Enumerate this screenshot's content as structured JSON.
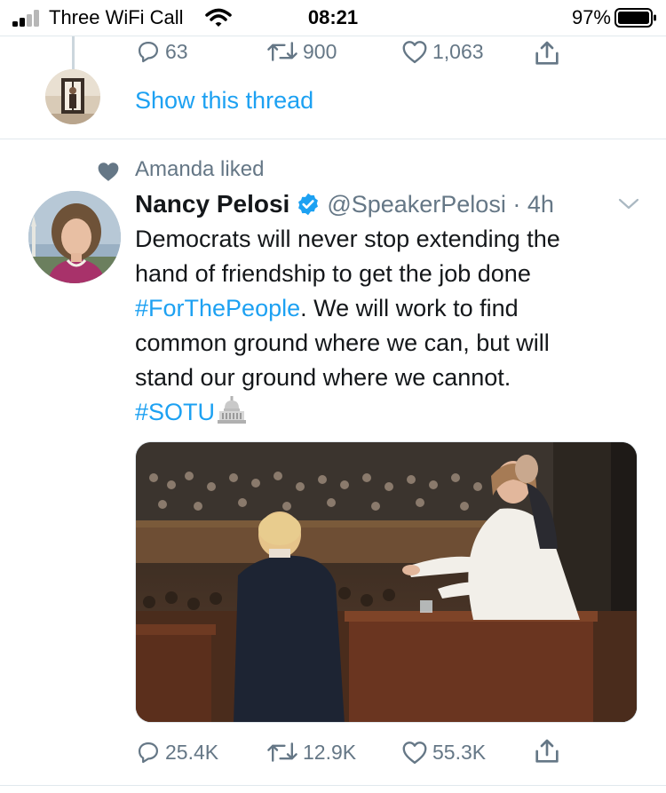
{
  "status_bar": {
    "carrier": "Three WiFi Call",
    "time": "08:21",
    "battery": "97%",
    "icons": [
      "signal-icon",
      "wifi-icon",
      "battery-icon"
    ]
  },
  "previous_tweet": {
    "replies": "63",
    "retweets": "900",
    "likes": "1,063",
    "show_thread": "Show this thread"
  },
  "tweet": {
    "social_context": "Amanda liked",
    "author_name": "Nancy Pelosi",
    "author_handle": "@SpeakerPelosi",
    "time_sep": " · ",
    "time": "4h",
    "lines": {
      "l1": "Democrats will never stop extending the",
      "l2": "hand of friendship to get the job done",
      "l3_tag": "#ForThePeople",
      "l3_rest": ". We will work to find",
      "l4": "common ground where we can, but will",
      "l5": "stand our ground where we cannot.",
      "l6_tag": "#SOTU"
    },
    "stats": {
      "replies": "25.4K",
      "retweets": "12.9K",
      "likes": "55.3K"
    }
  },
  "colors": {
    "link_blue": "#1da1f2",
    "secondary_text": "#657786",
    "divider": "#e1e8ed",
    "liked_heart": "#657786"
  }
}
